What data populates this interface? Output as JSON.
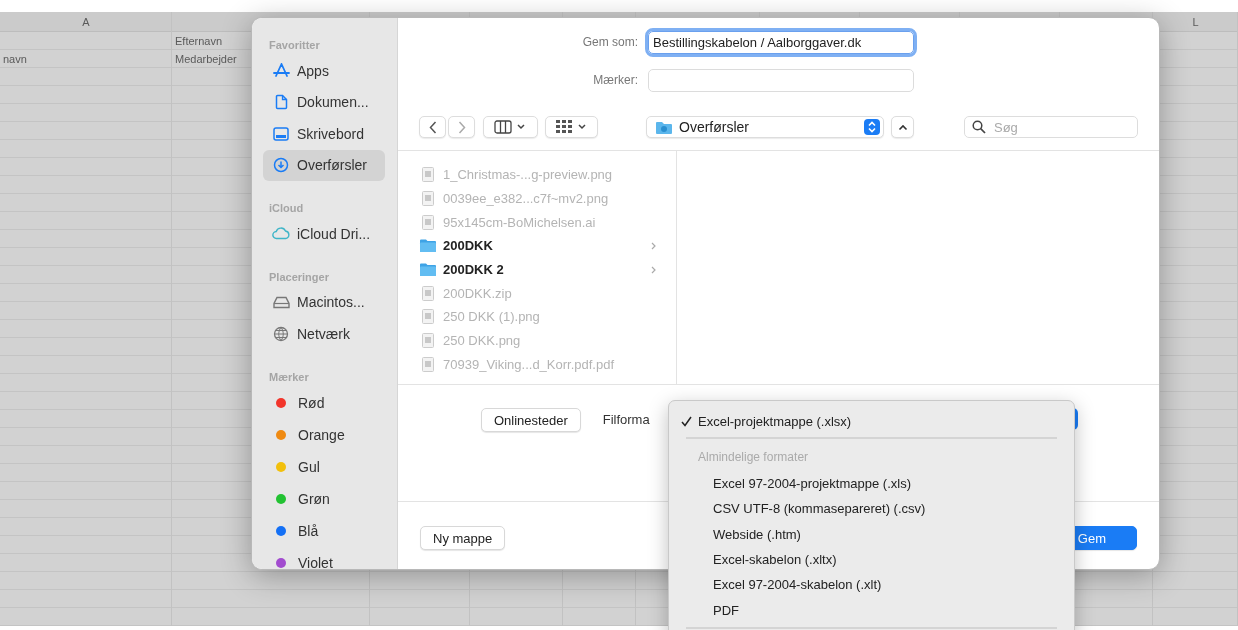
{
  "sheet": {
    "column_headers": [
      "A",
      "L"
    ],
    "rows": [
      {
        "column_b": "Efternavn"
      },
      {
        "column_a": "navn",
        "column_b": "Medarbejder"
      }
    ]
  },
  "dialog": {
    "sidebar": [
      {
        "title": "Favoritter",
        "items": [
          {
            "label": "Apps",
            "kind": "place",
            "selected": false
          },
          {
            "label": "Dokumen...",
            "kind": "place",
            "selected": false
          },
          {
            "label": "Skrivebord",
            "kind": "place",
            "selected": false
          },
          {
            "label": "Overførsler",
            "kind": "place",
            "selected": true
          }
        ]
      },
      {
        "title": "iCloud",
        "items": [
          {
            "label": "iCloud Dri...",
            "kind": "place",
            "selected": false
          }
        ]
      },
      {
        "title": "Placeringer",
        "items": [
          {
            "label": "Macintos...",
            "kind": "place",
            "selected": false
          },
          {
            "label": "Netværk",
            "kind": "place",
            "selected": false
          }
        ]
      },
      {
        "title": "Mærker",
        "items": [
          {
            "label": "Rød",
            "kind": "tag",
            "color": "#f2352b",
            "selected": false
          },
          {
            "label": "Orange",
            "kind": "tag",
            "color": "#ef8a12",
            "selected": false
          },
          {
            "label": "Gul",
            "kind": "tag",
            "color": "#f2c00c",
            "selected": false
          },
          {
            "label": "Grøn",
            "kind": "tag",
            "color": "#22c232",
            "selected": false
          },
          {
            "label": "Blå",
            "kind": "tag",
            "color": "#1470f5",
            "selected": false
          },
          {
            "label": "Violet",
            "kind": "tag",
            "color": "#a24ccf",
            "selected": false
          }
        ]
      }
    ],
    "save_as": {
      "label": "Gem som:",
      "value": "Bestillingskabelon / Aalborggaver.dk",
      "focused": true
    },
    "tags": {
      "label": "Mærker:"
    },
    "location": "Overførsler",
    "search": {
      "placeholder": "Søg"
    },
    "files": [
      {
        "name": "1_Christmas-...g-preview.png",
        "kind": "file",
        "disabled": true
      },
      {
        "name": "0039ee_e382...c7f~mv2.png",
        "kind": "file",
        "disabled": true
      },
      {
        "name": "95x145cm-BoMichelsen.ai",
        "kind": "file",
        "disabled": true
      },
      {
        "name": "200DKK",
        "kind": "folder",
        "disabled": false
      },
      {
        "name": "200DKK 2",
        "kind": "folder",
        "disabled": false
      },
      {
        "name": "200DKK.zip",
        "kind": "file",
        "disabled": true
      },
      {
        "name": "250 DKK (1).png",
        "kind": "file",
        "disabled": true
      },
      {
        "name": "250 DKK.png",
        "kind": "file",
        "disabled": true
      },
      {
        "name": "70939_Viking...d_Korr.pdf.pdf",
        "kind": "file",
        "disabled": true
      }
    ],
    "online_button": "Onlinesteder",
    "format_label": "Filforma",
    "new_folder_button": "Ny mappe",
    "save_button": "Gem"
  },
  "format_menu": [
    {
      "kind": "item",
      "label": "Excel-projektmappe (.xlsx)",
      "checked": true
    },
    {
      "kind": "separator"
    },
    {
      "kind": "heading",
      "label": "Almindelige formater"
    },
    {
      "kind": "item",
      "label": "Excel 97-2004-projektmappe (.xls)",
      "checked": false
    },
    {
      "kind": "item",
      "label": "CSV UTF-8 (kommasepareret) (.csv)",
      "checked": false
    },
    {
      "kind": "item",
      "label": "Webside (.htm)",
      "checked": false
    },
    {
      "kind": "item",
      "label": "Excel-skabelon (.xltx)",
      "checked": false
    },
    {
      "kind": "item",
      "label": "Excel 97-2004-skabelon (.xlt)",
      "checked": false
    },
    {
      "kind": "item",
      "label": "PDF",
      "checked": false
    },
    {
      "kind": "separator"
    }
  ]
}
